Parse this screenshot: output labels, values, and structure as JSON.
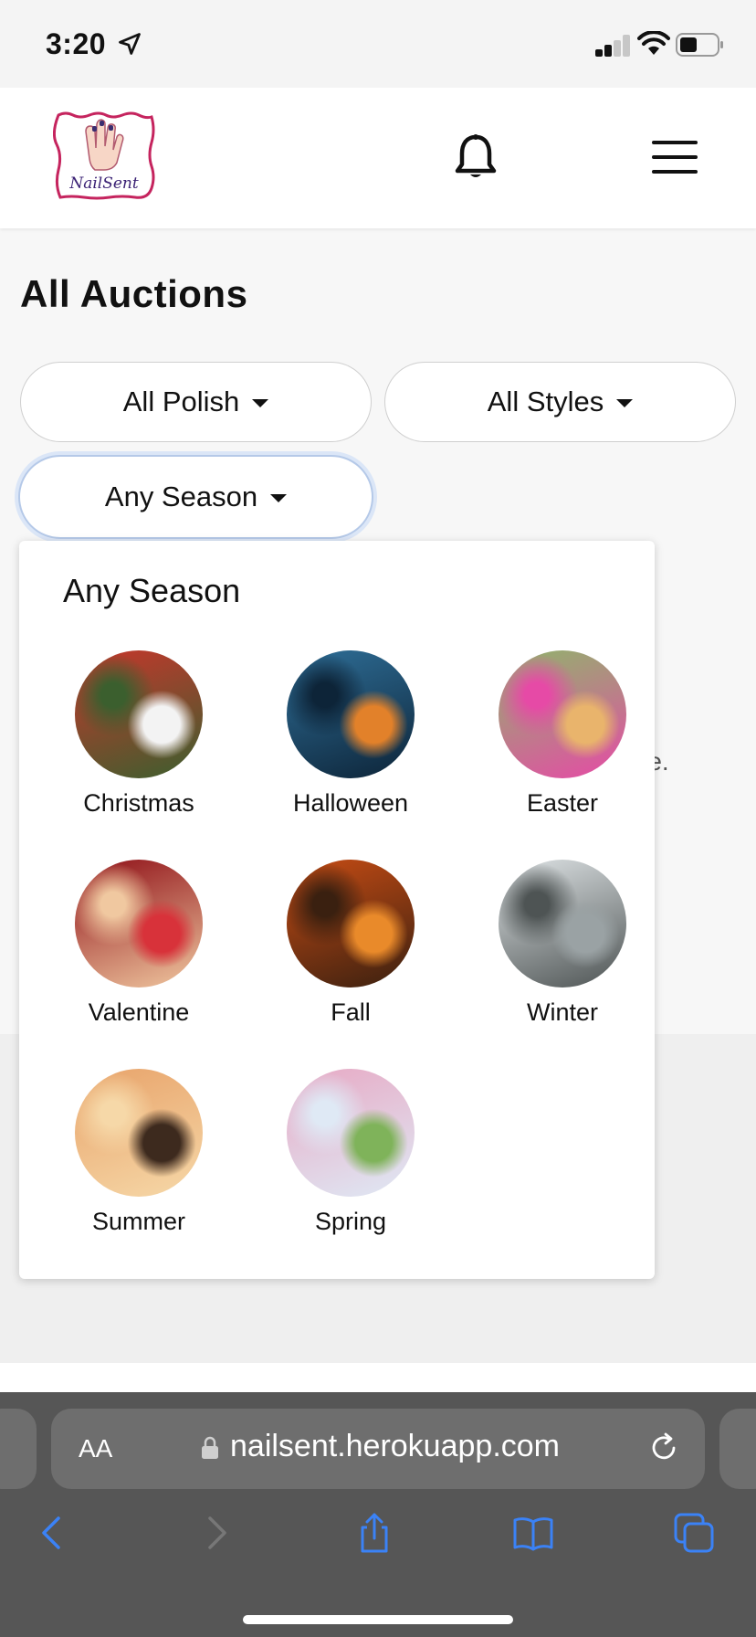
{
  "status_bar": {
    "time": "3:20"
  },
  "header": {
    "logo_text": "NailSent"
  },
  "page": {
    "title": "All Auctions"
  },
  "filters": {
    "polish": "All Polish",
    "styles": "All Styles",
    "season": "Any Season"
  },
  "background": {
    "partial_text": "re."
  },
  "dropdown": {
    "title": "Any Season",
    "items": [
      {
        "label": "Christmas",
        "colors": [
          "#c8362c",
          "#f3f3f3",
          "#3b5f2e"
        ]
      },
      {
        "label": "Halloween",
        "colors": [
          "#2f6f98",
          "#e2812a",
          "#0d2438"
        ]
      },
      {
        "label": "Easter",
        "colors": [
          "#8fb56b",
          "#e9b46c",
          "#e64aa6"
        ]
      },
      {
        "label": "Valentine",
        "colors": [
          "#8e0e16",
          "#d8323a",
          "#f0c8a0"
        ]
      },
      {
        "label": "Fall",
        "colors": [
          "#c74c14",
          "#e98a2a",
          "#3a2010"
        ]
      },
      {
        "label": "Winter",
        "colors": [
          "#dfe4e6",
          "#9aa2a4",
          "#4e5454"
        ]
      },
      {
        "label": "Summer",
        "colors": [
          "#e8a36a",
          "#3d2a1e",
          "#f6d8a8"
        ]
      },
      {
        "label": "Spring",
        "colors": [
          "#e7a9c4",
          "#7fb35a",
          "#dfe9f5"
        ]
      }
    ]
  },
  "browser": {
    "text_size_label": "AA",
    "url": "nailsent.herokuapp.com",
    "tint": "#3b82f6"
  }
}
